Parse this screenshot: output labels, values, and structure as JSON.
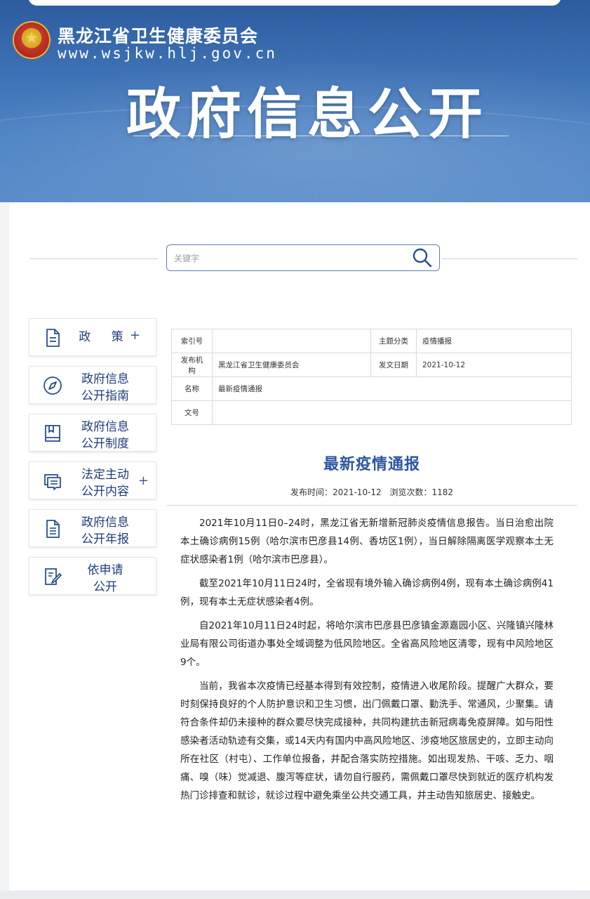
{
  "header": {
    "site_name": "黑龙江省卫生健康委员会",
    "site_url": "www.wsjkw.hlj.gov.cn",
    "hero_title": "政府信息公开"
  },
  "search": {
    "placeholder": "关键字"
  },
  "sidebar": {
    "items": [
      {
        "label": "政 策",
        "plus": "+"
      },
      {
        "label_line1": "政府信息",
        "label_line2": "公开指南"
      },
      {
        "label_line1": "政府信息",
        "label_line2": "公开制度"
      },
      {
        "label_line1": "法定主动",
        "label_line2": "公开内容",
        "plus": "+"
      },
      {
        "label_line1": "政府信息",
        "label_line2": "公开年报"
      },
      {
        "label_line1": "依申请",
        "label_line2": "公开"
      }
    ]
  },
  "meta": {
    "index_label": "索引号",
    "index_value": "",
    "topic_label": "主题分类",
    "topic_value": "疫情播报",
    "org_label": "发布机构",
    "org_value": "黑龙江省卫生健康委员会",
    "date_label": "发文日期",
    "date_value": "2021-10-12",
    "name_label": "名称",
    "name_value": "最新疫情通报",
    "docno_label": "文号",
    "docno_value": ""
  },
  "article": {
    "title": "最新疫情通报",
    "publish_time": "发布时间：2021-10-12",
    "views": "浏览次数：1182",
    "paragraphs": [
      "2021年10月11日0–24时，黑龙江省无新增新冠肺炎疫情信息报告。当日治愈出院本土确诊病例15例（哈尔滨市巴彦县14例、香坊区1例），当日解除隔离医学观察本土无症状感染者1例（哈尔滨市巴彦县）。",
      "截至2021年10月11日24时，全省现有境外输入确诊病例4例，现有本土确诊病例41例，现有本土无症状感染者4例。",
      "自2021年10月11日24时起，将哈尔滨市巴彦县巴彦镇金源嘉园小区、兴隆镇兴隆林业局有限公司街道办事处全域调整为低风险地区。全省高风险地区清零，现有中风险地区9个。",
      "当前，我省本次疫情已经基本得到有效控制，疫情进入收尾阶段。提醒广大群众，要时刻保持良好的个人防护意识和卫生习惯，出门佩戴口罩、勤洗手、常通风，少聚集。请符合条件却仍未接种的群众要尽快完成接种，共同构建抗击新冠病毒免疫屏障。如与阳性感染者活动轨迹有交集，或14天内有国内中高风险地区、涉疫地区旅居史的，立即主动向所在社区（村屯）、工作单位报备，并配合落实防控措施。如出现发热、干咳、乏力、咽痛、嗅（味）觉减退、腹泻等症状，请勿自行服药，需佩戴口罩尽快到就近的医疗机构发热门诊排查和就诊，就诊过程中避免乘坐公共交通工具，并主动告知旅居史、接触史。"
    ]
  },
  "colors": {
    "header_blue": "#3d70b4",
    "title_blue": "#2d56a3",
    "nav_text": "#1f3d7a"
  },
  "icons": [
    "national-emblem-icon",
    "search-icon",
    "document-icon",
    "compass-icon",
    "book-icon",
    "chat-list-icon",
    "report-icon",
    "edit-form-icon"
  ]
}
